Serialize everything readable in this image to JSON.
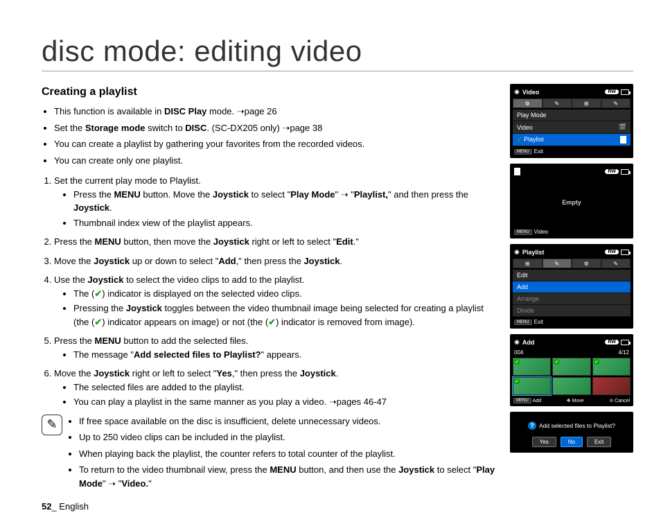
{
  "title": "disc mode: editing video",
  "subhead": "Creating a playlist",
  "intro": [
    {
      "pre": "This function is available in ",
      "b": "DISC Play",
      "post": " mode. ➝page 26"
    },
    {
      "pre": "Set the ",
      "b": "Storage mode",
      "post": " switch to ",
      "b2": "DISC",
      "post2": ". (SC-DX205 only) ➝page 38"
    },
    {
      "pre": "You can create a playlist by gathering your favorites from the recorded videos.",
      "b": "",
      "post": ""
    },
    {
      "pre": "You can create only one playlist.",
      "b": "",
      "post": ""
    }
  ],
  "steps": {
    "s1": "Set the current play mode to Playlist.",
    "s1a_pre": "Press the ",
    "s1a_b1": "MENU",
    "s1a_mid": " button. Move the ",
    "s1a_b2": "Joystick",
    "s1a_mid2": " to select \"",
    "s1a_b3": "Play Mode",
    "s1a_mid3": "\" ➝ \"",
    "s1a_b4": "Playlist,",
    "s1a_mid4": "\" and then press the ",
    "s1a_b5": "Joystick",
    "s1a_end": ".",
    "s1b": "Thumbnail index view of the playlist appears.",
    "s2_pre": "Press the ",
    "s2_b1": "MENU",
    "s2_mid": " button, then move the ",
    "s2_b2": "Joystick",
    "s2_mid2": " right or left to select \"",
    "s2_b3": "Edit",
    "s2_end": ".\"",
    "s3_pre": "Move the ",
    "s3_b1": "Joystick",
    "s3_mid": " up or down to select \"",
    "s3_b2": "Add",
    "s3_mid2": ",\" then press the ",
    "s3_b3": "Joystick",
    "s3_end": ".",
    "s4_pre": "Use the ",
    "s4_b1": "Joystick",
    "s4_end": " to select the video clips to add to the playlist.",
    "s4a_pre": "The (",
    "s4a_check": "✔",
    "s4a_post": ") indicator is displayed on the selected video clips.",
    "s4b_pre": "Pressing the ",
    "s4b_b1": "Joystick",
    "s4b_mid": " toggles between the video thumbnail image being selected for creating a playlist (the (",
    "s4b_c1": "✔",
    "s4b_mid2": ") indicator appears on image) or not (the (",
    "s4b_c2": "✔",
    "s4b_end": ") indicator is removed from image).",
    "s5_pre": "Press the ",
    "s5_b1": "MENU",
    "s5_end": " button to add the selected files.",
    "s5a_pre": "The message \"",
    "s5a_b1": "Add selected files to Playlist?",
    "s5a_end": "\" appears.",
    "s6_pre": "Move the ",
    "s6_b1": "Joystick",
    "s6_mid": " right or left to select \"",
    "s6_b2": "Yes",
    "s6_mid2": ",\" then press the ",
    "s6_b3": "Joystick",
    "s6_end": ".",
    "s6a": "The selected files are added to the playlist.",
    "s6b": "You can play a playlist in the same manner as you play a video. ➝pages 46-47"
  },
  "note": {
    "n1": "If free space available on the disc is insufficient, delete unnecessary videos.",
    "n2": "Up to 250 video clips can be included in the playlist.",
    "n3": "When playing back the playlist, the counter refers to total counter of the playlist.",
    "n4_pre": "To return to the video thumbnail view, press the ",
    "n4_b1": "MENU",
    "n4_mid": " button, and then use the ",
    "n4_b2": "Joystick",
    "n4_mid2": " to select \"",
    "n4_b3": "Play Mode",
    "n4_mid3": "\" ➝ \"",
    "n4_b4": "Video.",
    "n4_end": "\""
  },
  "footer_num": "52",
  "footer_lang": "_ English",
  "screens": {
    "s1": {
      "title": "Video",
      "rows": [
        "Play Mode",
        "Video",
        "Playlist"
      ],
      "foot": "Exit",
      "menu": "MENU"
    },
    "s2": {
      "empty": "Empty",
      "foot": "Video",
      "menu": "MENU"
    },
    "s3": {
      "title": "Playlist",
      "rows": [
        "Edit",
        "Add",
        "Arrange",
        "Divide"
      ],
      "foot": "Exit",
      "menu": "MENU"
    },
    "s4": {
      "title": "Add",
      "count": "004",
      "page": "4/12",
      "foot_add": "Add",
      "foot_move": "Move",
      "foot_cancel": "Cancel",
      "menu": "MENU"
    },
    "s5": {
      "q": "Add selected files to Playlist?",
      "yes": "Yes",
      "no": "No",
      "exit": "Exit"
    },
    "rw": "RW"
  }
}
